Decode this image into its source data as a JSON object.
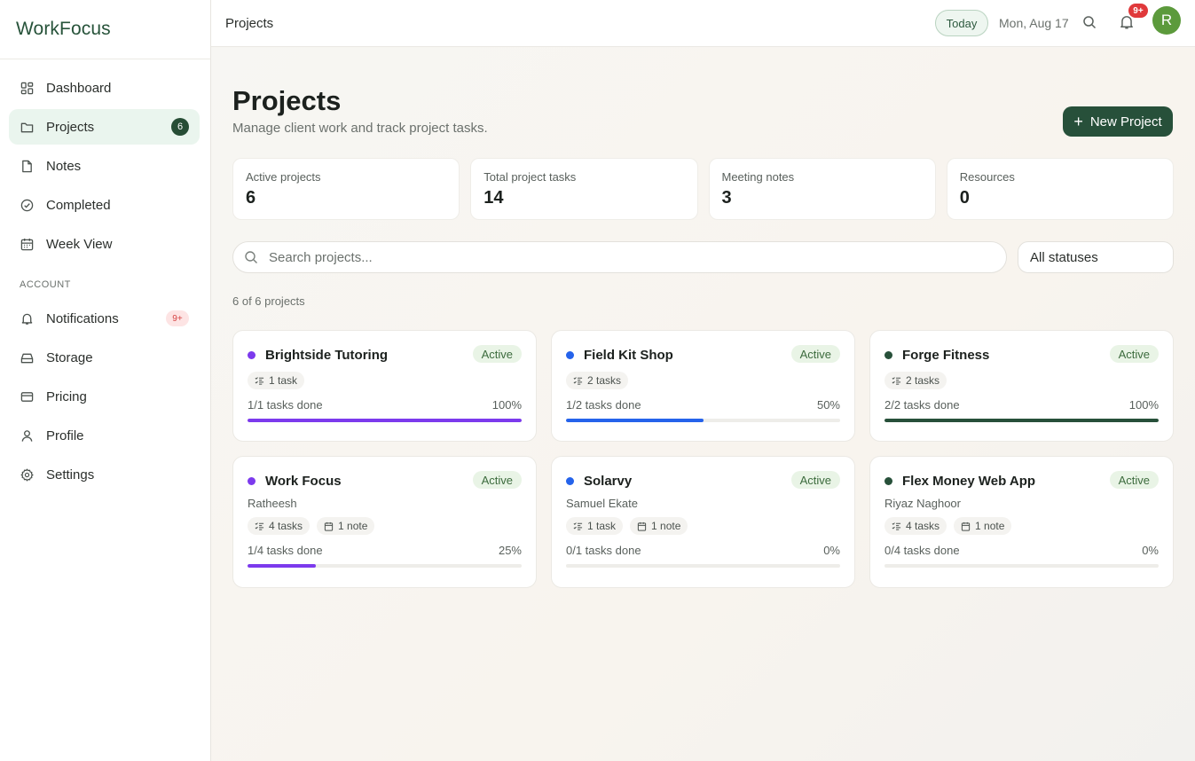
{
  "app": {
    "brand": "WorkFocus"
  },
  "sidebar": {
    "items": [
      {
        "label": "Dashboard",
        "icon": "dashboard-icon"
      },
      {
        "label": "Projects",
        "icon": "folder-icon",
        "count": "6",
        "active": true
      },
      {
        "label": "Notes",
        "icon": "note-icon"
      },
      {
        "label": "Completed",
        "icon": "check-circle-icon"
      },
      {
        "label": "Week View",
        "icon": "calendar-icon"
      }
    ],
    "account_label": "ACCOUNT",
    "account_items": [
      {
        "label": "Notifications",
        "icon": "bell-icon",
        "badge": "9+"
      },
      {
        "label": "Storage",
        "icon": "storage-icon"
      },
      {
        "label": "Pricing",
        "icon": "card-icon"
      },
      {
        "label": "Profile",
        "icon": "user-icon"
      },
      {
        "label": "Settings",
        "icon": "gear-icon"
      }
    ]
  },
  "topbar": {
    "breadcrumb": "Projects",
    "today_label": "Today",
    "date": "Mon, Aug 17",
    "notif_badge": "9+",
    "avatar_initial": "R"
  },
  "main": {
    "title": "Projects",
    "subtitle": "Manage client work and track project tasks.",
    "new_button": "New Project",
    "stats": [
      {
        "label": "Active projects",
        "value": "6"
      },
      {
        "label": "Total project tasks",
        "value": "14"
      },
      {
        "label": "Meeting notes",
        "value": "3"
      },
      {
        "label": "Resources",
        "value": "0"
      }
    ],
    "search_placeholder": "Search projects...",
    "status_filter": "All statuses",
    "count_text": "6 of 6 projects"
  },
  "projects": [
    {
      "name": "Brightside Tutoring",
      "color": "#7c3aed",
      "status": "Active",
      "owner": "",
      "tasks_chip": "1 task",
      "notes_chip": "",
      "progress_text": "1/1 tasks done",
      "percent_text": "100%",
      "progress": 1.0
    },
    {
      "name": "Field Kit Shop",
      "color": "#2563eb",
      "status": "Active",
      "owner": "",
      "tasks_chip": "2 tasks",
      "notes_chip": "",
      "progress_text": "1/2 tasks done",
      "percent_text": "50%",
      "progress": 0.5
    },
    {
      "name": "Forge Fitness",
      "color": "#27503a",
      "status": "Active",
      "owner": "",
      "tasks_chip": "2 tasks",
      "notes_chip": "",
      "progress_text": "2/2 tasks done",
      "percent_text": "100%",
      "progress": 1.0
    },
    {
      "name": "Work Focus",
      "color": "#7c3aed",
      "status": "Active",
      "owner": "Ratheesh",
      "tasks_chip": "4 tasks",
      "notes_chip": "1 note",
      "progress_text": "1/4 tasks done",
      "percent_text": "25%",
      "progress": 0.25
    },
    {
      "name": "Solarvy",
      "color": "#2563eb",
      "status": "Active",
      "owner": "Samuel Ekate",
      "tasks_chip": "1 task",
      "notes_chip": "1 note",
      "progress_text": "0/1 tasks done",
      "percent_text": "0%",
      "progress": 0
    },
    {
      "name": "Flex Money Web App",
      "color": "#27503a",
      "status": "Active",
      "owner": "Riyaz Naghoor",
      "tasks_chip": "4 tasks",
      "notes_chip": "1 note",
      "progress_text": "0/4 tasks done",
      "percent_text": "0%",
      "progress": 0
    }
  ]
}
